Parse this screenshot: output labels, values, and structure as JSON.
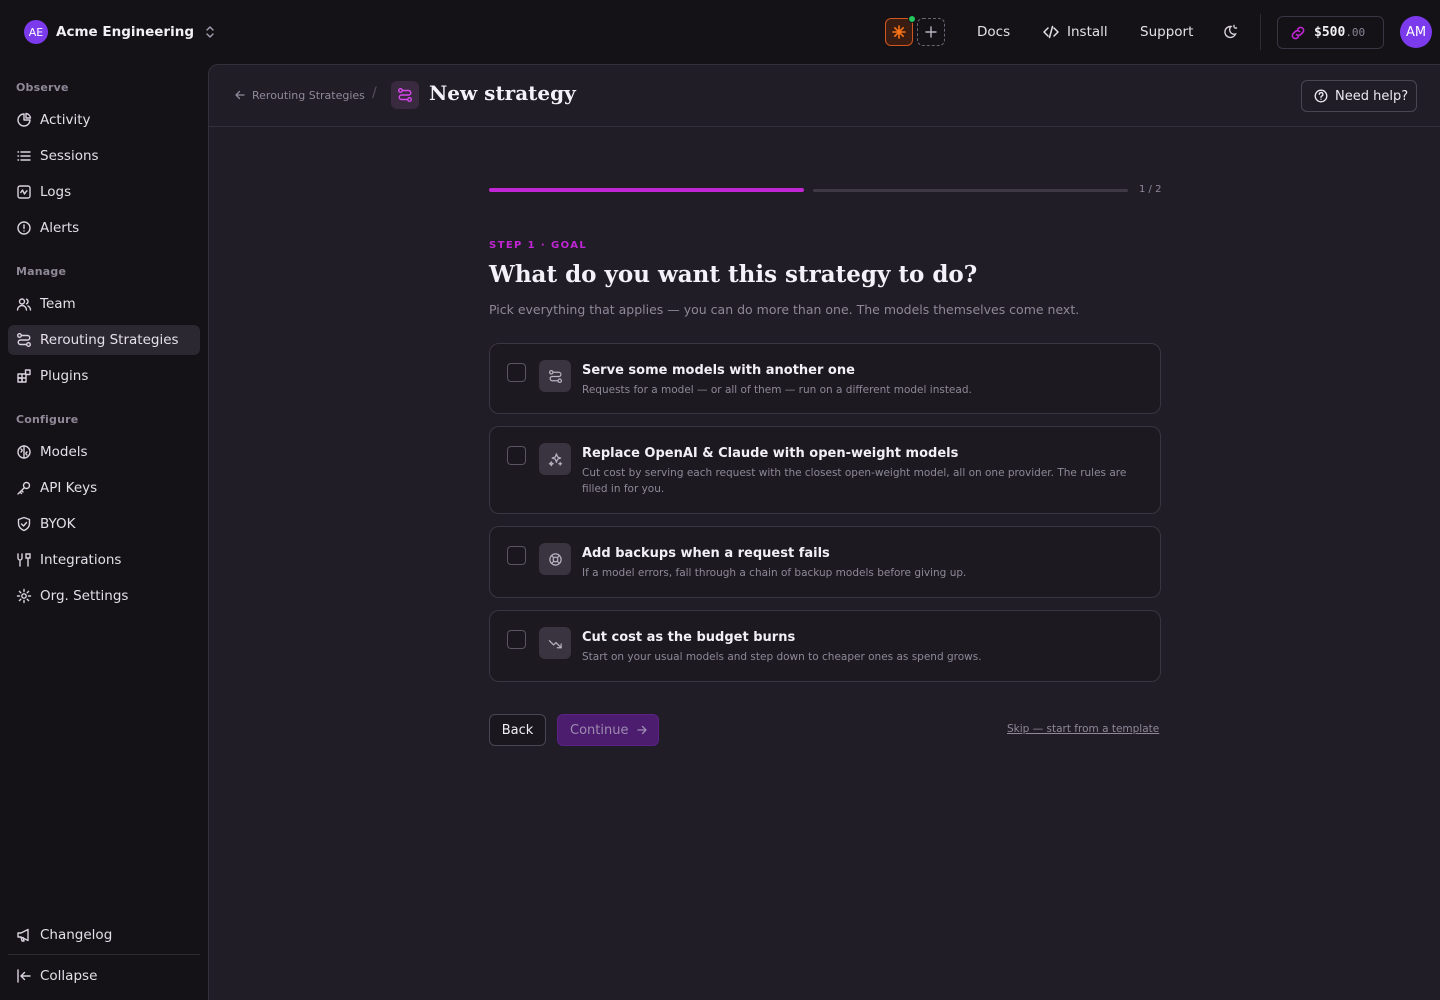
{
  "org": {
    "initials": "AE",
    "name": "Acme Engineering"
  },
  "top_links": {
    "docs": "Docs",
    "install": "Install",
    "support": "Support"
  },
  "credits": {
    "amount": "$500",
    "cents": ".00"
  },
  "user": {
    "initials": "AM"
  },
  "sidebar": {
    "sections": {
      "observe": "Observe",
      "manage": "Manage",
      "configure": "Configure"
    },
    "items": {
      "activity": "Activity",
      "sessions": "Sessions",
      "logs": "Logs",
      "alerts": "Alerts",
      "team": "Team",
      "rerouting": "Rerouting Strategies",
      "plugins": "Plugins",
      "models": "Models",
      "api_keys": "API Keys",
      "byok": "BYOK",
      "integrations": "Integrations",
      "org_settings": "Org. Settings"
    },
    "changelog": "Changelog",
    "collapse": "Collapse",
    "active_item": "Rerouting Strategies"
  },
  "header": {
    "breadcrumb_back": "Rerouting Strategies",
    "breadcrumb_sep": "/",
    "title": "New strategy",
    "help_label": "Need help?"
  },
  "wizard": {
    "progress_label": "1 / 2",
    "progress_fraction": 0.5,
    "step_label": "STEP 1 · GOAL",
    "question": "What do you want this strategy to do?",
    "subtitle": "Pick everything that applies — you can do more than one. The models themselves come next.",
    "options": [
      {
        "title": "Serve some models with another one",
        "desc": "Requests for a model — or all of them — run on a different model instead.",
        "icon": "route-icon",
        "checked": false
      },
      {
        "title": "Replace OpenAI & Claude with open-weight models",
        "desc": "Cut cost by serving each request with the closest open-weight model, all on one provider. The rules are filled in for you.",
        "icon": "sparkle-icon",
        "checked": false
      },
      {
        "title": "Add backups when a request fails",
        "desc": "If a model errors, fall through a chain of backup models before giving up.",
        "icon": "lifebuoy-icon",
        "checked": false
      },
      {
        "title": "Cut cost as the budget burns",
        "desc": "Start on your usual models and step down to cheaper ones as spend grows.",
        "icon": "trending-down-icon",
        "checked": false
      }
    ],
    "back_label": "Back",
    "continue_label": "Continue",
    "skip_label": "Skip — start from a template"
  },
  "colors": {
    "accent": "#c026d3",
    "avatar": "#7c3aed",
    "status_online": "#22c55e",
    "continue_bg": "#4c1d6e"
  }
}
